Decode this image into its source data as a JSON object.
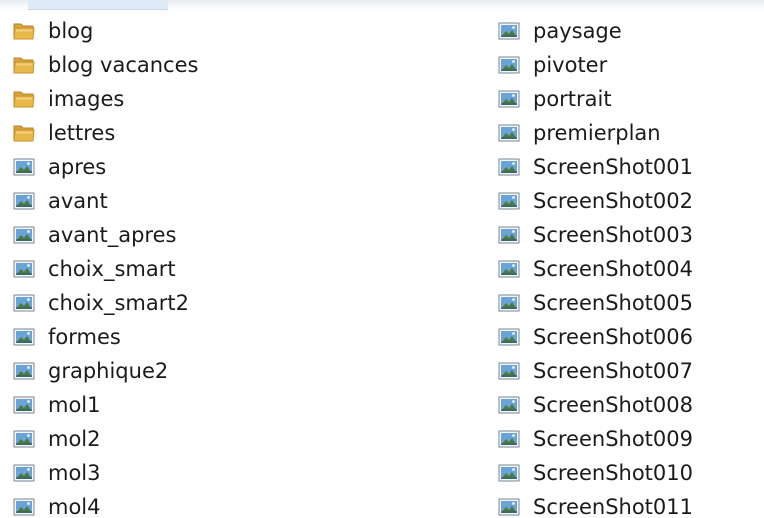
{
  "colors": {
    "background": "#ffffff",
    "text": "#1b1b1b",
    "folder": "#e8b84a",
    "image_icon_sky": "#6aa3d8"
  },
  "left_column": [
    {
      "label": "blog",
      "icon": "folder-icon"
    },
    {
      "label": "blog vacances",
      "icon": "folder-icon"
    },
    {
      "label": "images",
      "icon": "folder-icon"
    },
    {
      "label": "lettres",
      "icon": "folder-icon"
    },
    {
      "label": "apres",
      "icon": "image-file-icon"
    },
    {
      "label": "avant",
      "icon": "image-file-icon"
    },
    {
      "label": "avant_apres",
      "icon": "image-file-icon"
    },
    {
      "label": "choix_smart",
      "icon": "image-file-icon"
    },
    {
      "label": "choix_smart2",
      "icon": "image-file-icon"
    },
    {
      "label": "formes",
      "icon": "image-file-icon"
    },
    {
      "label": "graphique2",
      "icon": "image-file-icon"
    },
    {
      "label": "mol1",
      "icon": "image-file-icon"
    },
    {
      "label": "mol2",
      "icon": "image-file-icon"
    },
    {
      "label": "mol3",
      "icon": "image-file-icon"
    },
    {
      "label": "mol4",
      "icon": "image-file-icon"
    }
  ],
  "right_column": [
    {
      "label": "paysage",
      "icon": "image-file-icon"
    },
    {
      "label": "pivoter",
      "icon": "image-file-icon"
    },
    {
      "label": "portrait",
      "icon": "image-file-icon"
    },
    {
      "label": "premierplan",
      "icon": "image-file-icon"
    },
    {
      "label": "ScreenShot001",
      "icon": "image-file-icon"
    },
    {
      "label": "ScreenShot002",
      "icon": "image-file-icon"
    },
    {
      "label": "ScreenShot003",
      "icon": "image-file-icon"
    },
    {
      "label": "ScreenShot004",
      "icon": "image-file-icon"
    },
    {
      "label": "ScreenShot005",
      "icon": "image-file-icon"
    },
    {
      "label": "ScreenShot006",
      "icon": "image-file-icon"
    },
    {
      "label": "ScreenShot007",
      "icon": "image-file-icon"
    },
    {
      "label": "ScreenShot008",
      "icon": "image-file-icon"
    },
    {
      "label": "ScreenShot009",
      "icon": "image-file-icon"
    },
    {
      "label": "ScreenShot010",
      "icon": "image-file-icon"
    },
    {
      "label": "ScreenShot011",
      "icon": "image-file-icon"
    }
  ]
}
